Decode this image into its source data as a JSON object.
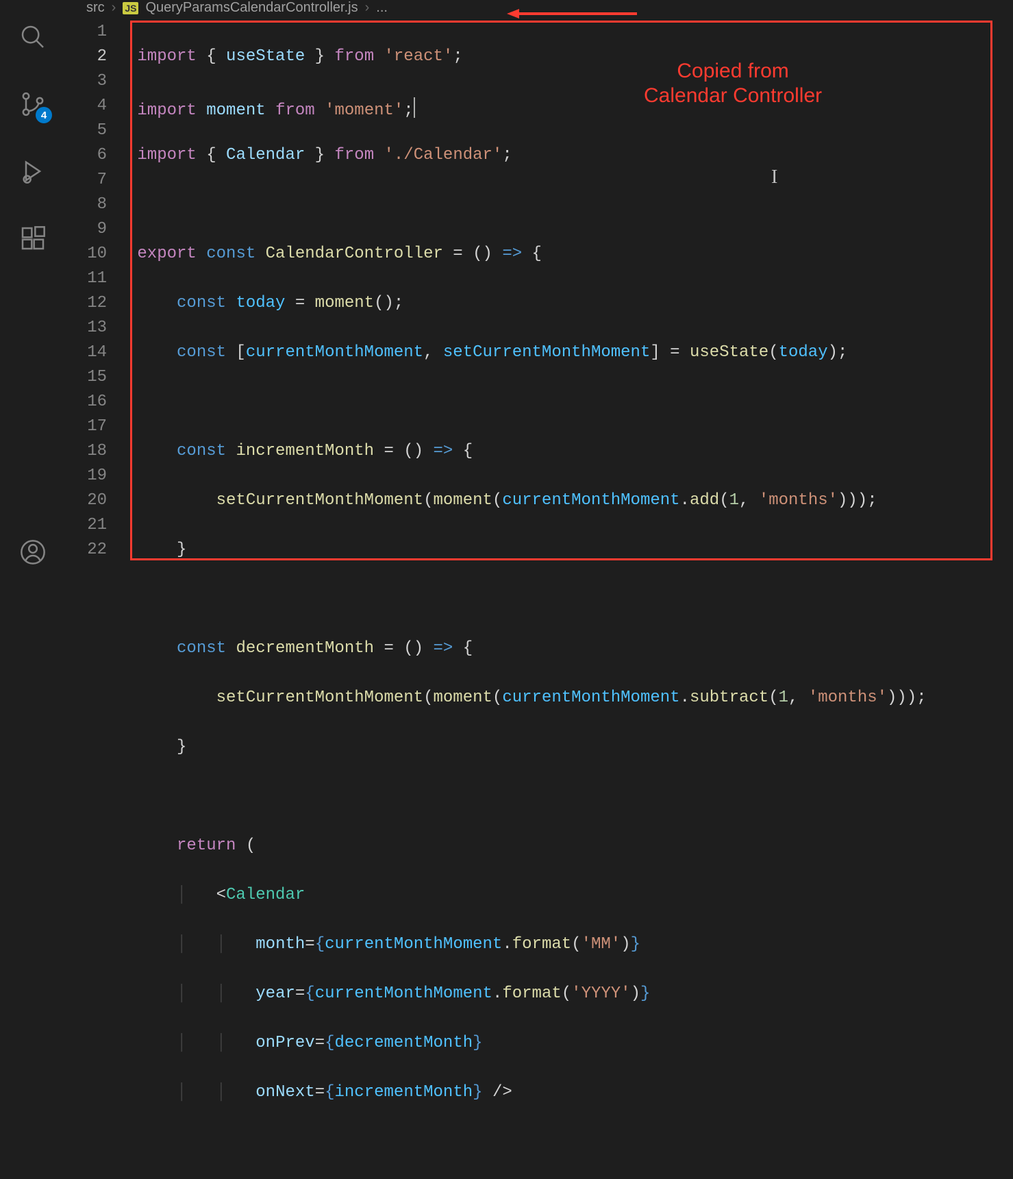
{
  "breadcrumb": {
    "folder": "src",
    "jsBadge": "JS",
    "file": "QueryParamsCalendarController.js",
    "ellipsis": "..."
  },
  "scmBadge": "4",
  "annotation": {
    "line1": "Copied from",
    "line2": "Calendar Controller"
  },
  "lines": [
    {
      "n": "1"
    },
    {
      "n": "2"
    },
    {
      "n": "3"
    },
    {
      "n": "4"
    },
    {
      "n": "5"
    },
    {
      "n": "6"
    },
    {
      "n": "7"
    },
    {
      "n": "8"
    },
    {
      "n": "9"
    },
    {
      "n": "10"
    },
    {
      "n": "11"
    },
    {
      "n": "12"
    },
    {
      "n": "13"
    },
    {
      "n": "14"
    },
    {
      "n": "15"
    },
    {
      "n": "16"
    },
    {
      "n": "17"
    },
    {
      "n": "18"
    },
    {
      "n": "19"
    },
    {
      "n": "20"
    },
    {
      "n": "21"
    },
    {
      "n": "22"
    }
  ],
  "code": {
    "l1": {
      "import": "import",
      "useState": "useState",
      "from": "from",
      "react": "'react'"
    },
    "l2": {
      "import": "import",
      "moment": "moment",
      "from": "from",
      "mod": "'moment'"
    },
    "l3": {
      "import": "import",
      "Calendar": "Calendar",
      "from": "from",
      "path": "'./Calendar'"
    },
    "l5": {
      "export": "export",
      "const": "const",
      "name": "CalendarController"
    },
    "l6": {
      "const": "const",
      "today": "today",
      "moment": "moment"
    },
    "l7": {
      "const": "const",
      "cur": "currentMonthMoment",
      "set": "setCurrentMonthMoment",
      "useState": "useState",
      "today": "today"
    },
    "l9": {
      "const": "const",
      "name": "incrementMonth"
    },
    "l10": {
      "set": "setCurrentMonthMoment",
      "moment": "moment",
      "cur": "currentMonthMoment",
      "add": "add",
      "one": "1",
      "months": "'months'"
    },
    "l13": {
      "const": "const",
      "name": "decrementMonth"
    },
    "l14": {
      "set": "setCurrentMonthMoment",
      "moment": "moment",
      "cur": "currentMonthMoment",
      "sub": "subtract",
      "one": "1",
      "months": "'months'"
    },
    "l17": {
      "return": "return"
    },
    "l18": {
      "Calendar": "Calendar"
    },
    "l19": {
      "attr": "month",
      "cur": "currentMonthMoment",
      "format": "format",
      "fmt": "'MM'"
    },
    "l20": {
      "attr": "year",
      "cur": "currentMonthMoment",
      "format": "format",
      "fmt": "'YYYY'"
    },
    "l21": {
      "attr": "onPrev",
      "val": "decrementMonth"
    },
    "l22": {
      "attr": "onNext",
      "val": "incrementMonth"
    }
  }
}
